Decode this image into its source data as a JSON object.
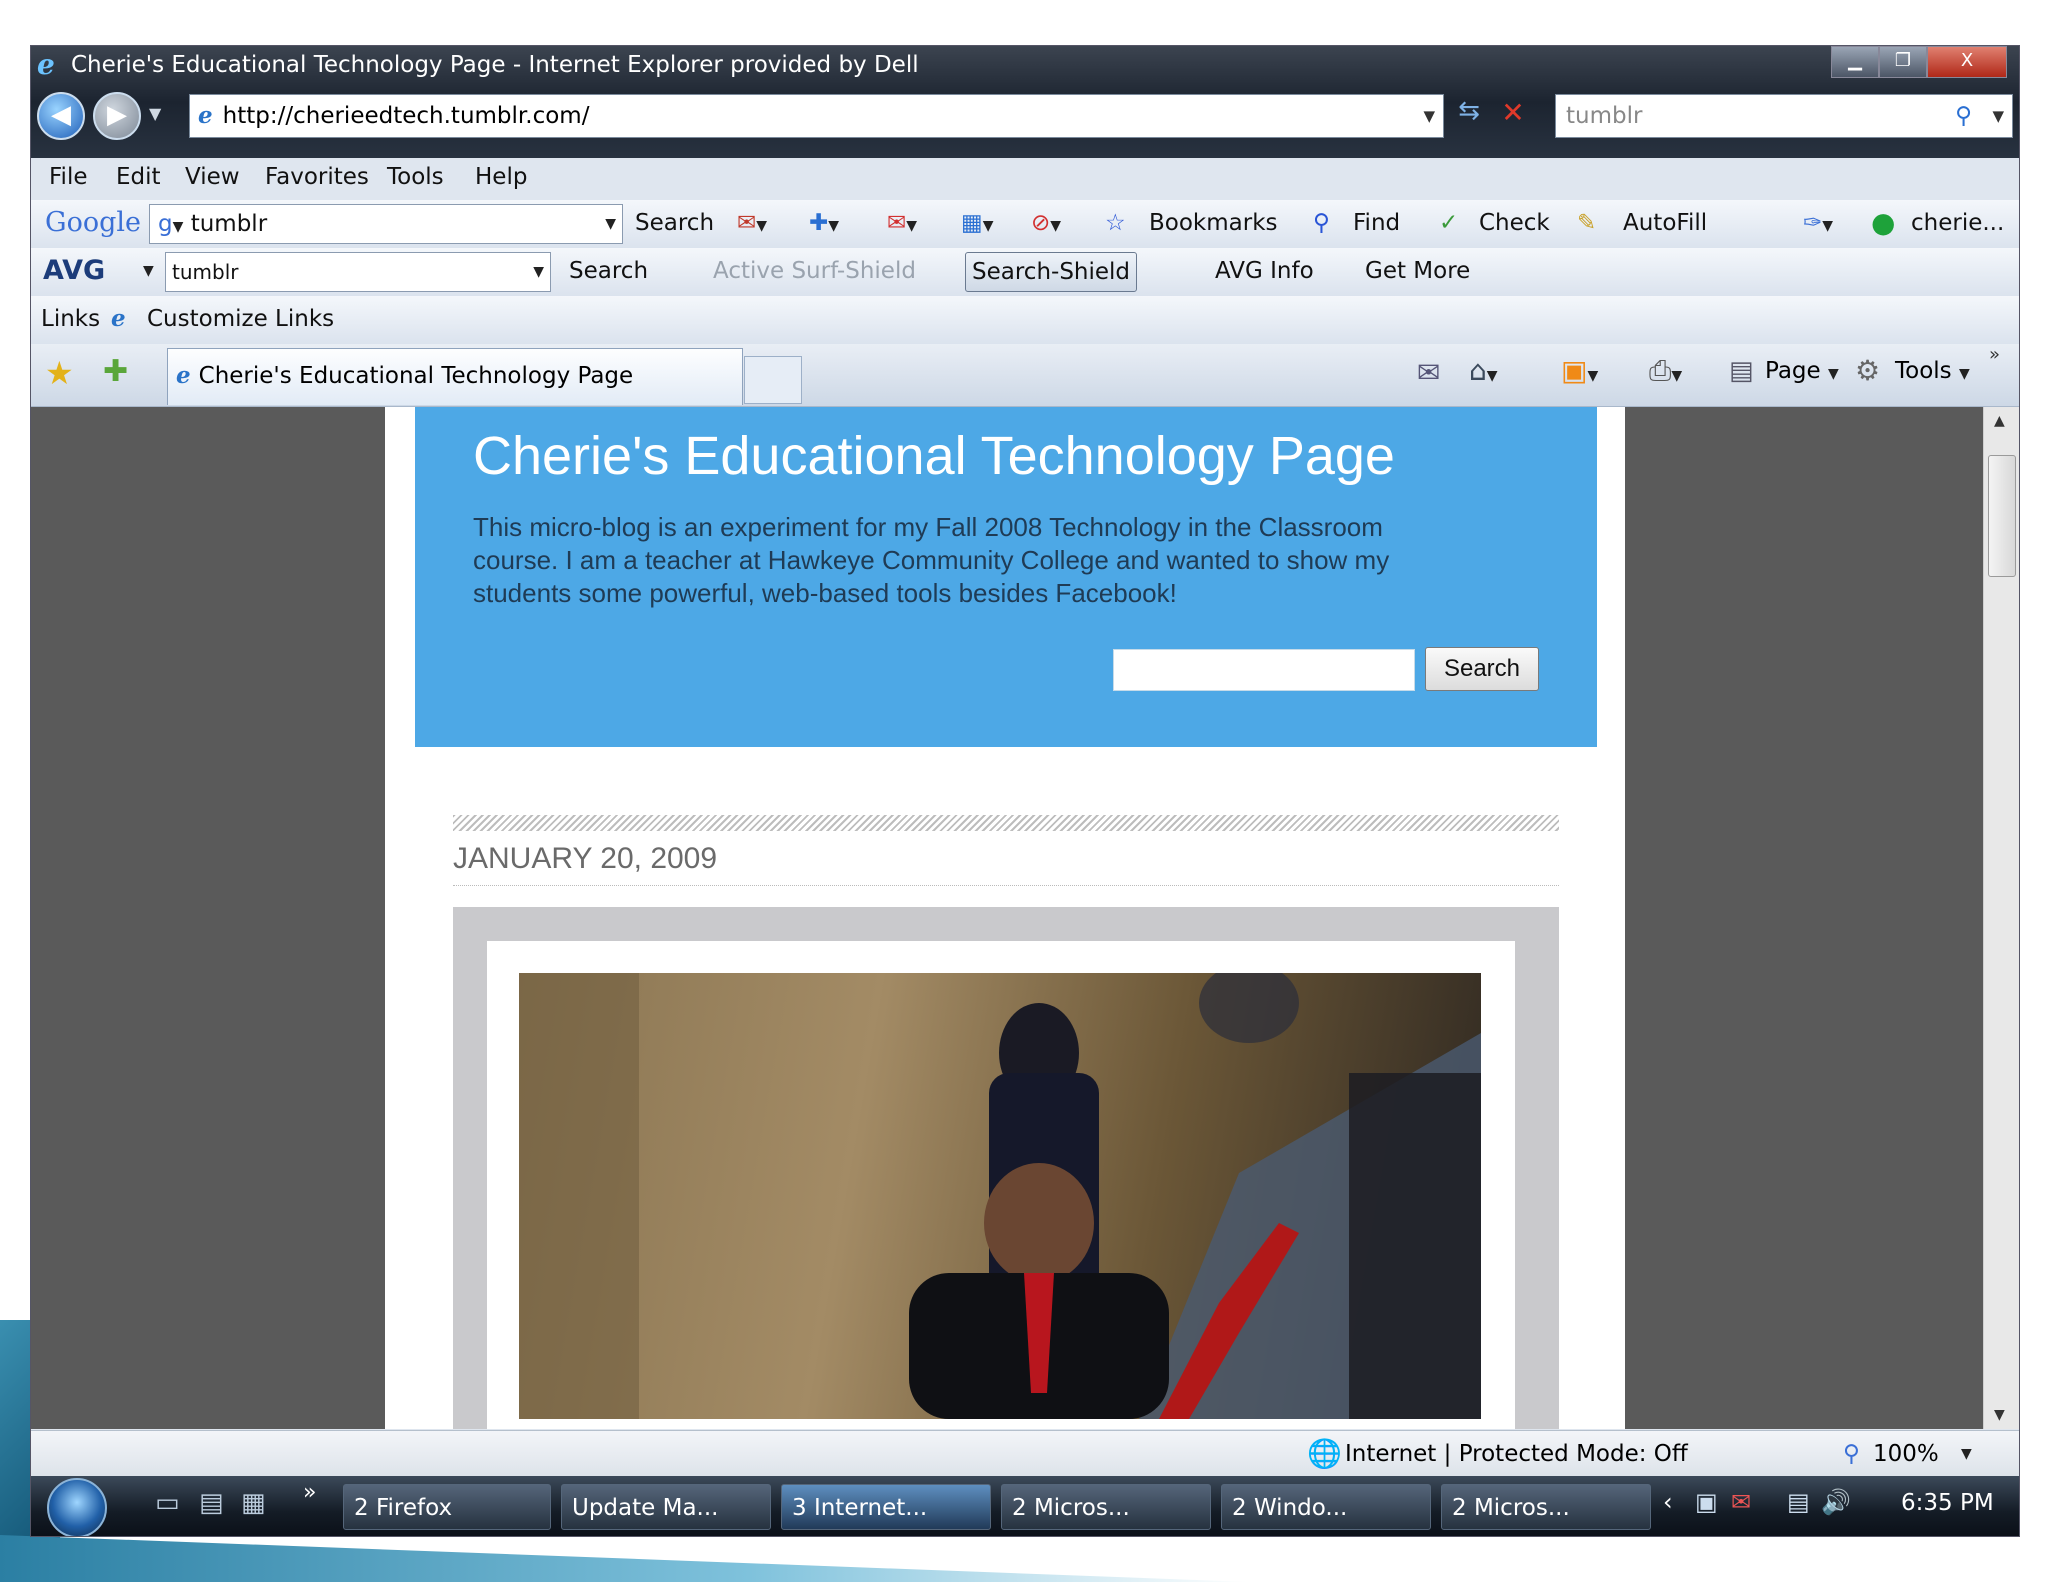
{
  "window": {
    "title": "Cherie's Educational Technology Page - Internet Explorer provided by Dell",
    "controls": {
      "minimize": "▁",
      "maximize": "❐",
      "close": "X"
    }
  },
  "nav": {
    "back_glyph": "◀",
    "forward_glyph": "▶",
    "url": "http://cherieedtech.tumblr.com/",
    "search_value": "tumblr"
  },
  "menu": [
    "File",
    "Edit",
    "View",
    "Favorites",
    "Tools",
    "Help"
  ],
  "google_bar": {
    "logo": "Google",
    "query": "tumblr",
    "search_label": "Search",
    "bookmarks_label": "Bookmarks",
    "find_label": "Find",
    "check_label": "Check",
    "autofill_label": "AutoFill",
    "account_label": "cherie..."
  },
  "avg_bar": {
    "logo": "AVG",
    "query": "tumblr",
    "search_label": "Search",
    "active_surf_label": "Active Surf-Shield",
    "search_shield_label": "Search-Shield",
    "info_label": "AVG Info",
    "get_more_label": "Get More"
  },
  "links_bar": {
    "links_label": "Links",
    "customize_label": "Customize Links"
  },
  "tabs": {
    "active_tab": "Cherie's Educational Technology Page",
    "page_label": "Page",
    "tools_label": "Tools"
  },
  "blog": {
    "title": "Cherie's Educational Technology Page",
    "description": "This micro-blog is an experiment for my Fall 2008 Technology in the Classroom course. I am a teacher at Hawkeye Community College and wanted to show my students some powerful, web-based tools besides Facebook!",
    "search_button": "Search",
    "post_date": "JANUARY 20, 2009"
  },
  "status": {
    "zone": "Internet | Protected Mode: Off",
    "zoom": "100%"
  },
  "taskbar": {
    "items": [
      "2 Firefox",
      "Update Ma...",
      "3 Internet...",
      "2 Micros...",
      "2 Windo...",
      "2 Micros..."
    ],
    "chevron": "»",
    "clock": "6:35 PM"
  }
}
